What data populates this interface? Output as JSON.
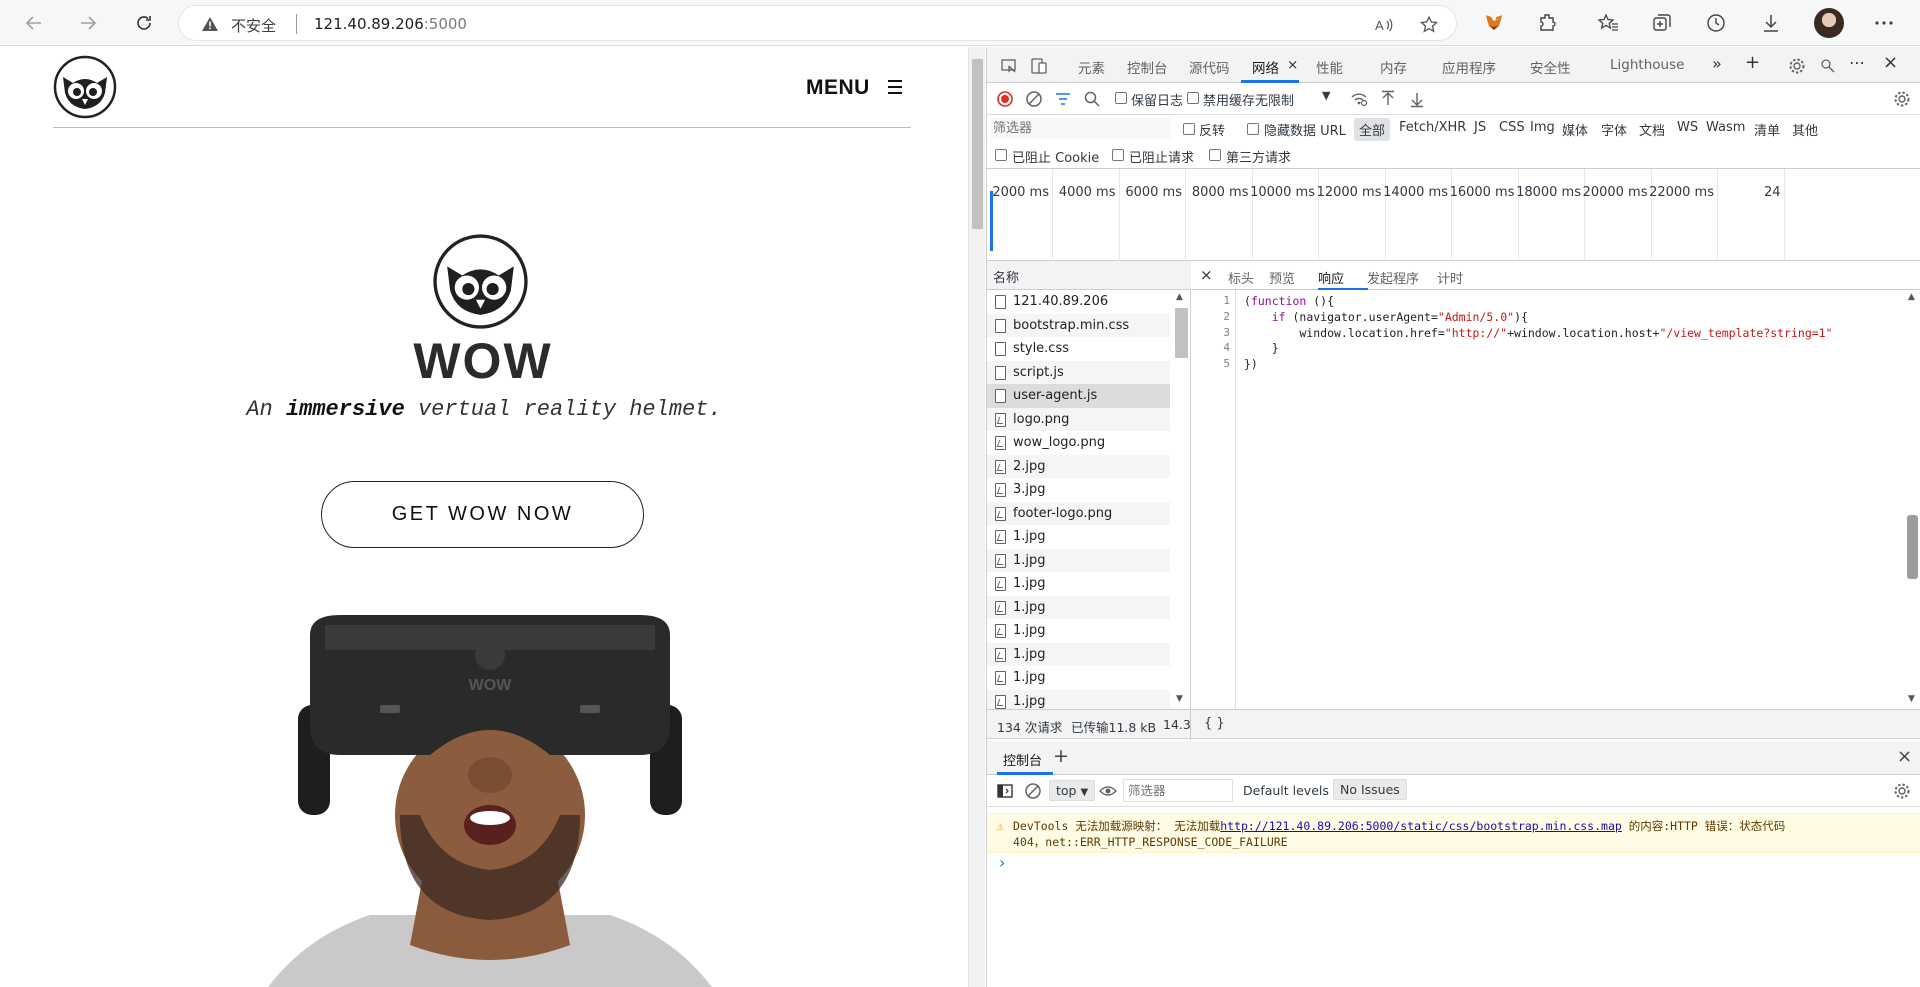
{
  "browser": {
    "insecure_label": "不安全",
    "url_host": "121.40.89.206",
    "url_port": ":5000"
  },
  "site": {
    "menu_label": "MENU",
    "hero_title": "WOW",
    "tagline_prefix": "An ",
    "tagline_emphasis": "immersive",
    "tagline_suffix": " vertual reality helmet.",
    "cta_label": "GET WOW NOW",
    "vr_helmet_label": "WOW"
  },
  "devtools": {
    "tabs": [
      "元素",
      "控制台",
      "源代码",
      "网络",
      "性能",
      "内存",
      "应用程序",
      "安全性",
      "Lighthouse"
    ],
    "active_tab": "网络",
    "toolbar": {
      "preserve_log": "保留日志",
      "disable_cache": "禁用缓存",
      "throttle": "无限制"
    },
    "filter": {
      "placeholder": "筛选器",
      "invert": "反转",
      "hide_data_urls": "隐藏数据 URL",
      "types": [
        "全部",
        "Fetch/XHR",
        "JS",
        "CSS",
        "Img",
        "媒体",
        "字体",
        "文档",
        "WS",
        "Wasm",
        "清单",
        "其他"
      ],
      "blocked_cookies": "已阻止 Cookie",
      "blocked_requests": "已阻止请求",
      "third_party": "第三方请求"
    },
    "timeline_ticks": [
      "2000 ms",
      "4000 ms",
      "6000 ms",
      "8000 ms",
      "10000 ms",
      "12000 ms",
      "14000 ms",
      "16000 ms",
      "18000 ms",
      "20000 ms",
      "22000 ms",
      "24"
    ],
    "requests_header": "名称",
    "requests": [
      "121.40.89.206",
      "bootstrap.min.css",
      "style.css",
      "script.js",
      "user-agent.js",
      "logo.png",
      "wow_logo.png",
      "2.jpg",
      "3.jpg",
      "footer-logo.png",
      "1.jpg",
      "1.jpg",
      "1.jpg",
      "1.jpg",
      "1.jpg",
      "1.jpg",
      "1.jpg",
      "1.jpg"
    ],
    "selected_request": "user-agent.js",
    "detail_tabs": [
      "标头",
      "预览",
      "响应",
      "发起程序",
      "计时"
    ],
    "active_detail_tab": "响应",
    "code_lines": [
      "(function (){",
      "    if (navigator.userAgent=\"Admin/5.0\"){",
      "        window.location.href=\"http://\"+window.location.host+\"/view_template?string=1\"",
      "    }",
      "})"
    ],
    "status": {
      "requests": "134 次请求",
      "transferred": "已传输11.8 kB",
      "resources": "14.3",
      "format_btn": "{ }"
    },
    "drawer": {
      "tab": "控制台",
      "context": "top",
      "filter_placeholder": "筛选器",
      "levels": "Default levels",
      "issues": "No Issues",
      "warning_prefix": "DevTools 无法加载源映射： 无法加载",
      "warning_link": "http://121.40.89.206:5000/static/css/bootstrap.min.css.map",
      "warning_suffix": " 的内容:HTTP 错误：状态代码",
      "warning_line2": "404，net::ERR_HTTP_RESPONSE_CODE_FAILURE",
      "prompt": "›"
    }
  }
}
